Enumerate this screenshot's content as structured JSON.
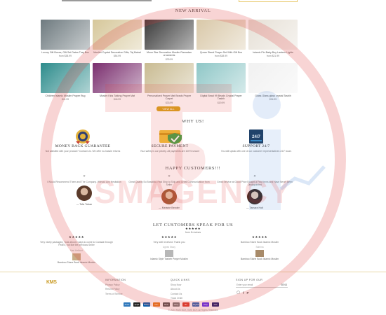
{
  "new_arrival": {
    "title": "NEW ARRIVAL",
    "view_all": "VIEW ALL",
    "products": [
      {
        "name": "Luxury Gift Boxes, Gift Set Dates Tray Box",
        "price": "from $38.99",
        "icon": "gift-box-image",
        "color": "#6e7a7f"
      },
      {
        "name": "Muslim Crystal Decorative Gifts, Taj Mahal",
        "price": "$54.99",
        "icon": "taj-mahal-image",
        "color": "#d6c79a"
      },
      {
        "name": "Moon Star Decoration Muslim Ramadan ornaments",
        "price": "$33.99",
        "icon": "moon-star-image",
        "color": "#3b3b3b"
      },
      {
        "name": "Quran Stand Prayer Set With Gift Box",
        "price": "from $38.99",
        "icon": "quran-stand-image",
        "color": "#d9c8a8"
      },
      {
        "name": "Islamic Pin Baby Boy Lantern Lights",
        "price": "from $21.99",
        "icon": "lantern-lights-image",
        "color": "#e6e0d6"
      },
      {
        "name": "Children Islamic Muslim Prayer Rug",
        "price": "$41.99",
        "icon": "prayer-rug-kids-image",
        "color": "#2d8c8c"
      },
      {
        "name": "Muslim Kids Talking Prayer Mat",
        "price": "$46.99",
        "icon": "talking-prayer-mat-image",
        "color": "#7a2e6e"
      },
      {
        "name": "Personalized Prayer Mat Beads Prayer Carpet",
        "price": "$33.99",
        "icon": "prayer-carpet-image",
        "color": "#c9bb92"
      },
      {
        "name": "Digital Bead 99 Beads Crystal Prayer Tasbih",
        "price": "$19.99",
        "icon": "crystal-tasbih-image",
        "color": "#8fc7c7"
      },
      {
        "name": "Glass Glass glass crystal Tasbih",
        "price": "$34.99",
        "icon": "glass-tasbih-image",
        "color": "#f1f1f1"
      }
    ]
  },
  "why_us": {
    "title": "WHY US!",
    "items": [
      {
        "title": "MONEY BACK GUARANTEE",
        "desc": "Not satisfied with your product? Contact Us. We offer no-hassle returns",
        "icon": "money-back-badge-icon"
      },
      {
        "title": "SECURE PAYMENT",
        "desc": "Your safety is our priority. All payments are 100% secure",
        "icon": "secure-payment-shield-icon"
      },
      {
        "title": "SUPPORT 24/7",
        "desc": "You will speak with one of our customer representatives 24/7 hours",
        "icon": "support-24-7-icon"
      }
    ]
  },
  "happy_customers": {
    "title": "HAPPY CUSTOMERS!!!",
    "items": [
      {
        "text": "I Would Recommend Them and The Company. Without Any Hesitation",
        "name": "— Tofa Tuban"
      },
      {
        "text": "Great Quality So Beautiful, Fast Ship to Ship and Great Communication from Seller",
        "name": "— Melanie Bender"
      },
      {
        "text": "Great Service at Good Price Bought a Few Items and Have Never Been Disappointed",
        "name": "— Tamara Holt"
      }
    ]
  },
  "reviews": {
    "title": "LET CUSTOMERS SPEAK FOR US",
    "summary_stars": "★★★★★",
    "summary": "from 8 reviews",
    "items": [
      {
        "stars": "★★★★★",
        "text": "Very nicely packaged. Took about 2 days to come to Canada through FedEx, not like the previous Seller",
        "by": "Mari Heilbert",
        "product": "Bamboo Stone Book Islamic Muslim"
      },
      {
        "stars": "★★★★★",
        "text": "Very well received. Thank you",
        "by": "Agnes Stacy",
        "product": "Islamic Style Tasbeh Prayer Muslim"
      },
      {
        "stars": "★★★★★",
        "text": "Bamboo Stone Book Islamic Muslim",
        "by": "Sabrina",
        "product": "Bamboo Stone Book Islamic Muslim"
      }
    ]
  },
  "footer": {
    "logo": "KMS",
    "information": {
      "title": "INFORMATION",
      "links": [
        "Privacy Policy",
        "Refund Policy",
        "Terms of Service"
      ]
    },
    "quick_links": {
      "title": "QUICK LINKS",
      "links": [
        "Shop Now",
        "About Us",
        "Contact Us",
        "Track Order"
      ]
    },
    "newsletter": {
      "title": "SIGN UP FOR OUR",
      "placeholder": "Enter your email",
      "button": "SEND"
    },
    "socials": [
      "instagram-icon",
      "facebook-icon",
      "pinterest-icon"
    ],
    "payments": [
      {
        "name": "Amex",
        "color": "#2e77bb"
      },
      {
        "name": "Apple",
        "color": "#222"
      },
      {
        "name": "Diners",
        "color": "#0a5ca8"
      },
      {
        "name": "Disc",
        "color": "#e47a1b"
      },
      {
        "name": "Meta",
        "color": "#555"
      },
      {
        "name": "GPay",
        "color": "#777"
      },
      {
        "name": "MC",
        "color": "#d93c2c"
      },
      {
        "name": "PayPal",
        "color": "#2a66b8"
      },
      {
        "name": "Shop",
        "color": "#5a31f4"
      },
      {
        "name": "Visa",
        "color": "#1a1f71"
      }
    ],
    "copyright": "© 2024 KMS BOX, KMS BOX All Rights Reserved"
  },
  "colors": {
    "accent": "#d9a520",
    "watermark": "#e03a3a"
  }
}
